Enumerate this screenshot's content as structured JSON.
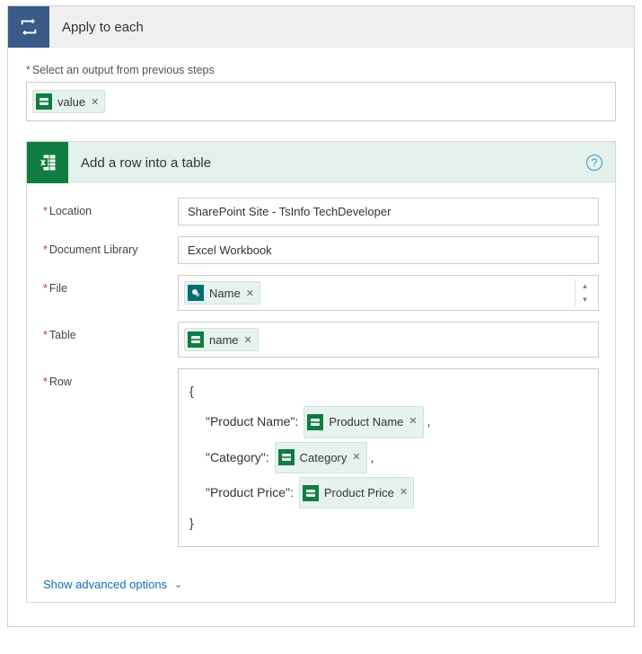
{
  "header": {
    "title": "Apply to each"
  },
  "outputField": {
    "label": "Select an output from previous steps",
    "token": "value"
  },
  "action": {
    "title": "Add a row into a table",
    "help": "?",
    "fields": {
      "location": {
        "label": "Location",
        "value": "SharePoint Site - TsInfo TechDeveloper"
      },
      "library": {
        "label": "Document Library",
        "value": "Excel Workbook"
      },
      "file": {
        "label": "File",
        "token": "Name"
      },
      "table": {
        "label": "Table",
        "token": "name"
      },
      "row": {
        "label": "Row",
        "open": "{",
        "close": "}",
        "entries": [
          {
            "key": "\"Product Name\":",
            "token": "Product Name",
            "trail": ","
          },
          {
            "key": "\"Category\":",
            "token": "Category",
            "trail": ","
          },
          {
            "key": "\"Product Price\":",
            "token": "Product Price",
            "trail": ""
          }
        ]
      }
    },
    "advanced": "Show advanced options"
  }
}
